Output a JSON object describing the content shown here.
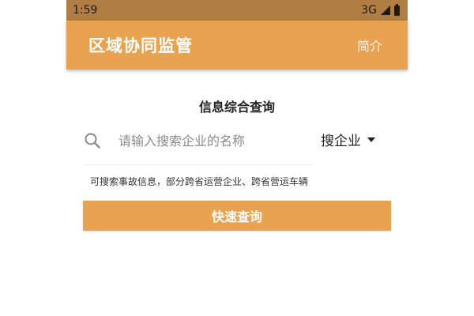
{
  "status_bar": {
    "time": "1:59",
    "network": "3G"
  },
  "app_bar": {
    "title": "区域协同监管",
    "action_label": "简介"
  },
  "search": {
    "section_title": "信息综合查询",
    "placeholder": "请输入搜索企业的名称",
    "value": "",
    "type_selected": "搜企业",
    "hint": "可搜索事故信息，部分跨省运营企业、跨省营运车辆",
    "submit_label": "快速查询"
  },
  "colors": {
    "primary": "#e8a250",
    "status_bar": "#b07d43"
  },
  "icons": [
    "search-icon",
    "chevron-down-icon",
    "signal-icon",
    "battery-icon"
  ]
}
